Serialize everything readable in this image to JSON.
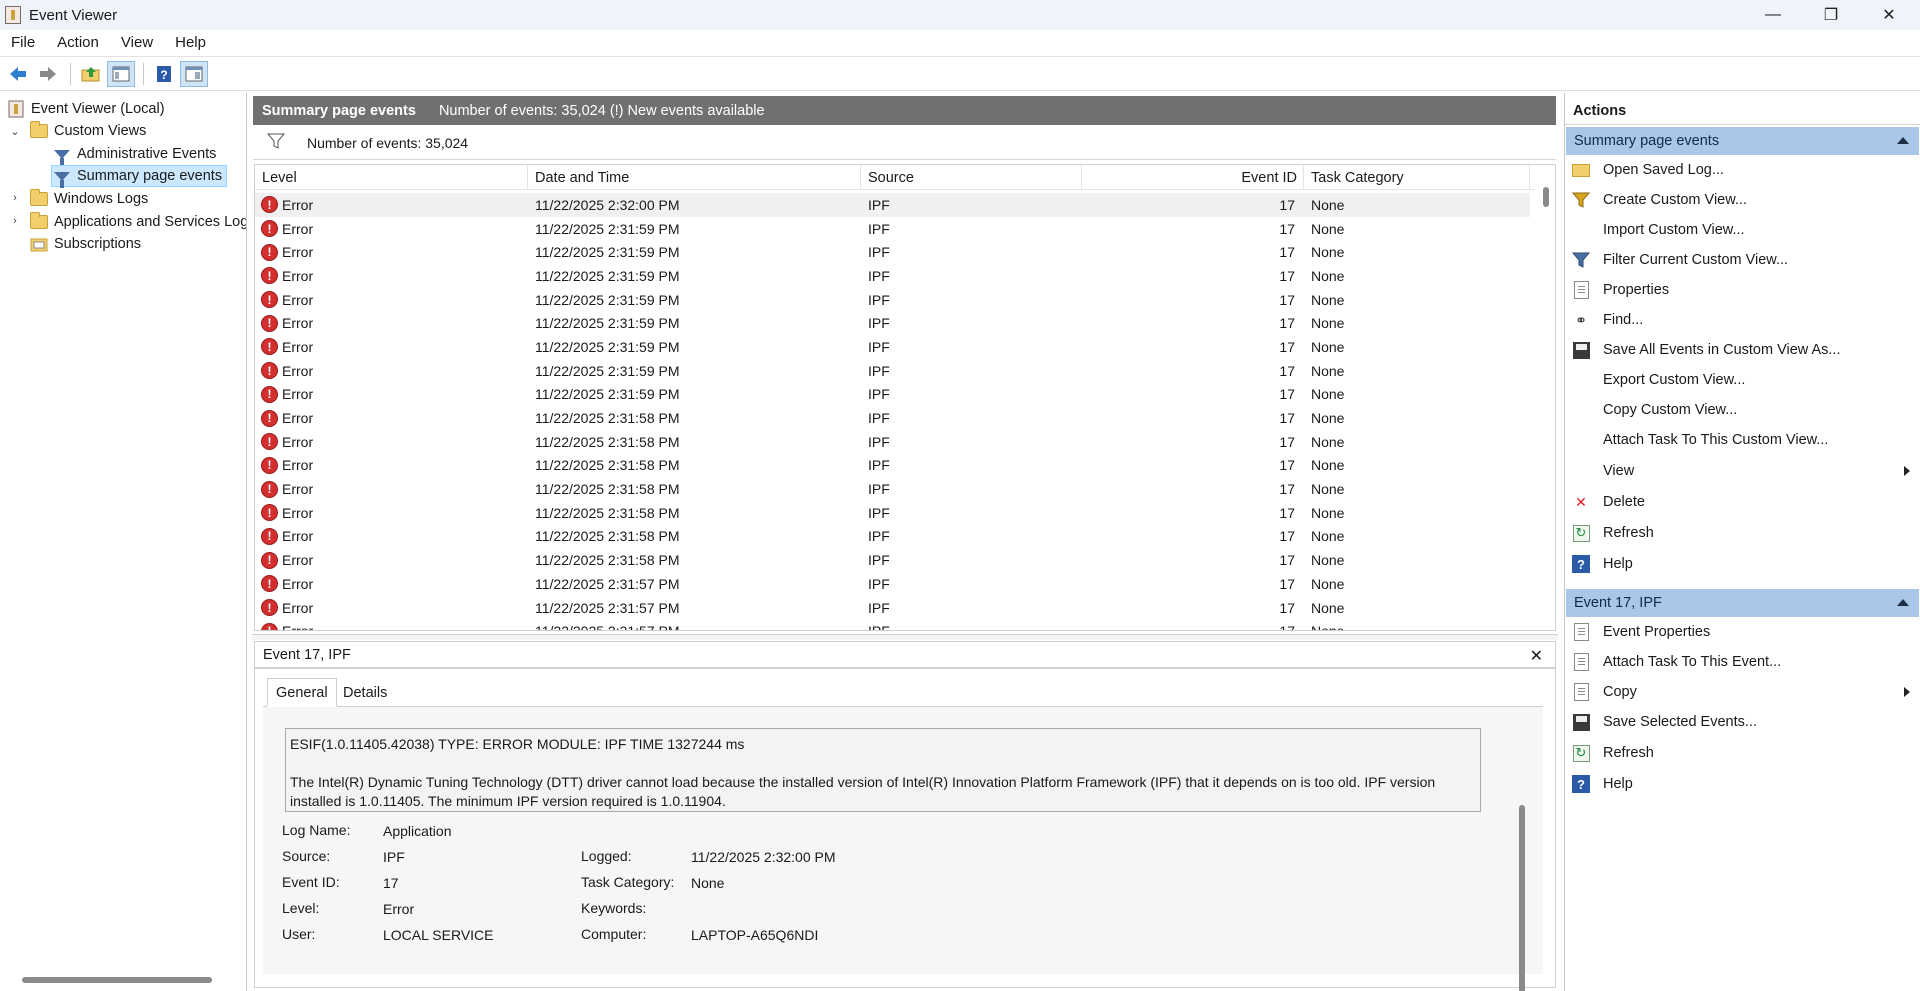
{
  "window": {
    "title": "Event Viewer",
    "controls": {
      "minimize": "—",
      "maximize": "❐",
      "close": "✕"
    }
  },
  "menu": [
    "File",
    "Action",
    "View",
    "Help"
  ],
  "tree": {
    "root": "Event Viewer (Local)",
    "custom_views": "Custom Views",
    "administrative_events": "Administrative Events",
    "summary_page_events": "Summary page events",
    "windows_logs": "Windows Logs",
    "app_services_logs": "Applications and Services Logs",
    "subscriptions": "Subscriptions"
  },
  "center": {
    "header_title": "Summary page events",
    "header_info": "Number of events: 35,024 (!) New events available",
    "filter_text": "Number of events: 35,024",
    "columns": {
      "level": "Level",
      "date": "Date and Time",
      "source": "Source",
      "event_id": "Event ID",
      "task_category": "Task Category"
    },
    "rows": [
      {
        "level": "Error",
        "date": "11/22/2025 2:32:00 PM",
        "source": "IPF",
        "event_id": "17",
        "task_category": "None"
      },
      {
        "level": "Error",
        "date": "11/22/2025 2:31:59 PM",
        "source": "IPF",
        "event_id": "17",
        "task_category": "None"
      },
      {
        "level": "Error",
        "date": "11/22/2025 2:31:59 PM",
        "source": "IPF",
        "event_id": "17",
        "task_category": "None"
      },
      {
        "level": "Error",
        "date": "11/22/2025 2:31:59 PM",
        "source": "IPF",
        "event_id": "17",
        "task_category": "None"
      },
      {
        "level": "Error",
        "date": "11/22/2025 2:31:59 PM",
        "source": "IPF",
        "event_id": "17",
        "task_category": "None"
      },
      {
        "level": "Error",
        "date": "11/22/2025 2:31:59 PM",
        "source": "IPF",
        "event_id": "17",
        "task_category": "None"
      },
      {
        "level": "Error",
        "date": "11/22/2025 2:31:59 PM",
        "source": "IPF",
        "event_id": "17",
        "task_category": "None"
      },
      {
        "level": "Error",
        "date": "11/22/2025 2:31:59 PM",
        "source": "IPF",
        "event_id": "17",
        "task_category": "None"
      },
      {
        "level": "Error",
        "date": "11/22/2025 2:31:59 PM",
        "source": "IPF",
        "event_id": "17",
        "task_category": "None"
      },
      {
        "level": "Error",
        "date": "11/22/2025 2:31:58 PM",
        "source": "IPF",
        "event_id": "17",
        "task_category": "None"
      },
      {
        "level": "Error",
        "date": "11/22/2025 2:31:58 PM",
        "source": "IPF",
        "event_id": "17",
        "task_category": "None"
      },
      {
        "level": "Error",
        "date": "11/22/2025 2:31:58 PM",
        "source": "IPF",
        "event_id": "17",
        "task_category": "None"
      },
      {
        "level": "Error",
        "date": "11/22/2025 2:31:58 PM",
        "source": "IPF",
        "event_id": "17",
        "task_category": "None"
      },
      {
        "level": "Error",
        "date": "11/22/2025 2:31:58 PM",
        "source": "IPF",
        "event_id": "17",
        "task_category": "None"
      },
      {
        "level": "Error",
        "date": "11/22/2025 2:31:58 PM",
        "source": "IPF",
        "event_id": "17",
        "task_category": "None"
      },
      {
        "level": "Error",
        "date": "11/22/2025 2:31:58 PM",
        "source": "IPF",
        "event_id": "17",
        "task_category": "None"
      },
      {
        "level": "Error",
        "date": "11/22/2025 2:31:57 PM",
        "source": "IPF",
        "event_id": "17",
        "task_category": "None"
      },
      {
        "level": "Error",
        "date": "11/22/2025 2:31:57 PM",
        "source": "IPF",
        "event_id": "17",
        "task_category": "None"
      },
      {
        "level": "Error",
        "date": "11/22/2025 2:31:57 PM",
        "source": "IPF",
        "event_id": "17",
        "task_category": "None"
      }
    ]
  },
  "detail": {
    "title": "Event 17, IPF",
    "close": "✕",
    "tabs": {
      "general": "General",
      "details": "Details"
    },
    "message_line1": "ESIF(1.0.11405.42038) TYPE: ERROR MODULE: IPF TIME 1327244 ms",
    "message_line2": "The Intel(R) Dynamic Tuning Technology (DTT) driver cannot load because the installed version of Intel(R) Innovation Platform Framework (IPF) that it depends on is too old.  IPF version installed is 1.0.11405.  The minimum IPF version required is 1.0.11904.",
    "labels": {
      "log_name": "Log Name:",
      "source": "Source:",
      "event_id": "Event ID:",
      "level": "Level:",
      "user": "User:",
      "logged": "Logged:",
      "task_category": "Task Category:",
      "keywords": "Keywords:",
      "computer": "Computer:"
    },
    "values": {
      "log_name": "Application",
      "source": "IPF",
      "event_id": "17",
      "level": "Error",
      "user": "LOCAL SERVICE",
      "logged": "11/22/2025 2:32:00 PM",
      "task_category": "None",
      "keywords": "",
      "computer": "LAPTOP-A65Q6NDI"
    }
  },
  "actions": {
    "title": "Actions",
    "section1": "Summary page events",
    "items1": {
      "open_saved_log": "Open Saved Log...",
      "create_custom_view": "Create Custom View...",
      "import_custom_view": "Import Custom View...",
      "filter_current": "Filter Current Custom View...",
      "properties": "Properties",
      "find": "Find...",
      "save_all": "Save All Events in Custom View As...",
      "export": "Export Custom View...",
      "copy_view": "Copy Custom View...",
      "attach_task_view": "Attach Task To This Custom View...",
      "view": "View",
      "delete": "Delete",
      "refresh": "Refresh",
      "help": "Help"
    },
    "section2": "Event 17, IPF",
    "items2": {
      "event_properties": "Event Properties",
      "attach_task_event": "Attach Task To This Event...",
      "copy": "Copy",
      "save_selected": "Save Selected Events...",
      "refresh": "Refresh",
      "help": "Help"
    }
  },
  "colors": {
    "accent": "#a9c7e8",
    "header_gray": "#707070",
    "error_red": "#d32f2f",
    "selection": "#cce8ff"
  }
}
